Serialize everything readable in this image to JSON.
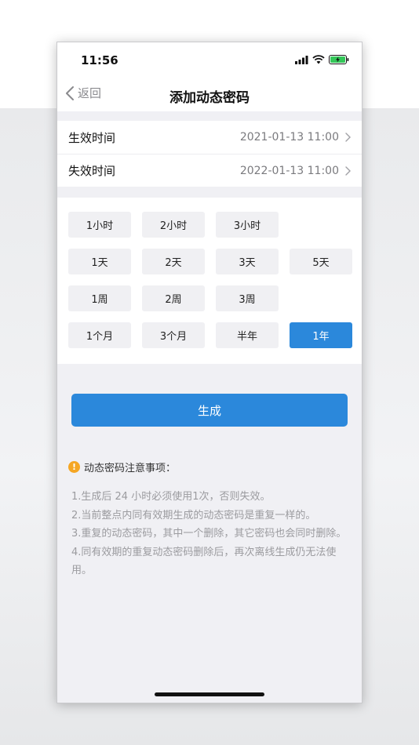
{
  "status": {
    "time": "11:56"
  },
  "nav": {
    "back_label": "返回",
    "title": "添加动态密码"
  },
  "rows": [
    {
      "label": "生效时间",
      "value": "2021-01-13 11:00"
    },
    {
      "label": "失效时间",
      "value": "2022-01-13 11:00"
    }
  ],
  "quick": {
    "r1": [
      "1小时",
      "2小时",
      "3小时"
    ],
    "r2": [
      "1天",
      "2天",
      "3天",
      "5天"
    ],
    "r3": [
      "1周",
      "2周",
      "3周"
    ],
    "r4": [
      "1个月",
      "3个月",
      "半年",
      "1年"
    ],
    "selected": "1年"
  },
  "generate_label": "生成",
  "notice": {
    "title": "动态密码注意事项：",
    "items": [
      "1.生成后 24 小时必须使用1次，否则失效。",
      "2.当前整点内同有效期生成的动态密码是重复一样的。",
      "3.重复的动态密码，其中一个删除，其它密码也会同时删除。",
      "4.同有效期的重复动态密码删除后，再次离线生成仍无法使用。"
    ]
  },
  "colors": {
    "accent": "#2b88db",
    "warning": "#f5a623",
    "page_bg": "#f0f0f4"
  },
  "icons": [
    "signal-icon",
    "wifi-icon",
    "battery-icon",
    "chevron-left-icon",
    "chevron-right-icon",
    "warning-icon"
  ]
}
